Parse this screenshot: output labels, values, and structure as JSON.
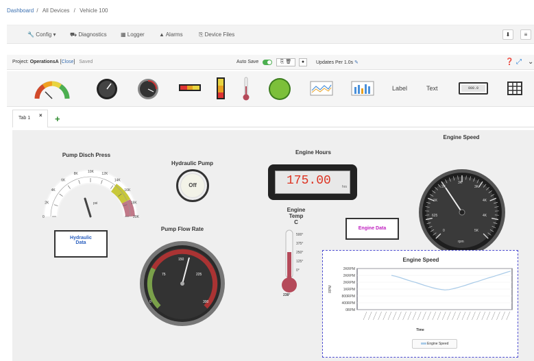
{
  "breadcrumb": {
    "dashboard": "Dashboard",
    "sep": "/",
    "devices": "All Devices",
    "vehicle": "Vehicle 100"
  },
  "topbar": {
    "config": "Config ▾",
    "diagnostics": "Diagnostics",
    "logger": "Logger",
    "alarms": "Alarms",
    "device_files": "Device Files"
  },
  "project": {
    "label": "Project:",
    "name": "OperationsA",
    "close": "Close",
    "saved": "Saved",
    "autosave_label": "Auto Save",
    "updates": "Updates Per 1.0s"
  },
  "palette": {
    "label_text": "Label",
    "text_text": "Text",
    "digital_text": "000.0"
  },
  "tabs": [
    {
      "label": "Tab 1"
    }
  ],
  "widgets": {
    "pump_disch": {
      "title": "Pump Disch Press",
      "unit": "psi",
      "ticks": [
        "0",
        "2K",
        "4K",
        "6K",
        "8K",
        "10K",
        "12K",
        "14K",
        "16K",
        "18K",
        "20K"
      ]
    },
    "hyd_data": {
      "label": "Hydraulic\nData"
    },
    "hyd_pump": {
      "title": "Hydraulic Pump",
      "state": "Off"
    },
    "pump_flow": {
      "title": "Pump Flow Rate",
      "ticks": [
        "0",
        "75",
        "150",
        "225",
        "300"
      ]
    },
    "engine_hours": {
      "title": "Engine Hours",
      "value": "175.00",
      "unit": "hrs"
    },
    "engine_temp": {
      "title": "Engine\nTemp\nC",
      "ticks": [
        "500°",
        "375°",
        "250°",
        "125°",
        "0°"
      ],
      "value": "238°"
    },
    "engine_data": {
      "label": "Engine Data"
    },
    "engine_speed_gauge": {
      "title": "Engine Speed",
      "ticks": [
        "0",
        "625",
        "1K",
        "2K",
        "3K",
        "3K",
        "4K",
        "4K",
        "5K"
      ],
      "unit": "rpm"
    },
    "engine_speed_chart": {
      "title": "Engine Speed",
      "legend": "Engine Speed",
      "xlabel": "Time",
      "ylabel": "RPM"
    }
  },
  "chart_data": {
    "type": "line",
    "title": "Engine Speed",
    "xlabel": "Time",
    "ylabel": "RPM",
    "y_ticks": [
      "0RPM",
      "400RPM",
      "800RPM",
      "1KRPM",
      "2KRPM",
      "2KRPM",
      "2KRPM"
    ],
    "series": [
      {
        "name": "Engine Speed",
        "values": [
          2000,
          1950,
          1880,
          1800,
          1720,
          1650,
          1580,
          1500,
          1420,
          1350,
          1280,
          1220,
          1180,
          1150,
          1170,
          1220,
          1280,
          1350,
          1420,
          1500,
          1580,
          1650,
          1730,
          1810,
          1880,
          1950,
          2030,
          2100,
          2180,
          2250
        ]
      }
    ],
    "color": "#a9cbe8",
    "ylim": [
      0,
      2400
    ]
  }
}
